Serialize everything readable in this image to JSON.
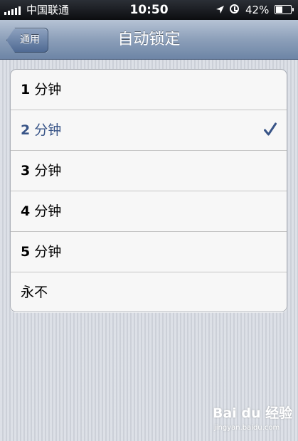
{
  "status_bar": {
    "carrier": "中国联通",
    "time": "10:50",
    "battery": "42%"
  },
  "nav": {
    "back_label": "通用",
    "title": "自动锁定"
  },
  "options": [
    {
      "num": "1",
      "unit": " 分钟"
    },
    {
      "num": "2",
      "unit": " 分钟",
      "selected": true
    },
    {
      "num": "3",
      "unit": " 分钟"
    },
    {
      "num": "4",
      "unit": " 分钟"
    },
    {
      "num": "5",
      "unit": " 分钟"
    },
    {
      "num": "",
      "unit": "永不"
    }
  ],
  "watermark": {
    "logo": "Bai du 经验",
    "url": "jingyan.baidu.com"
  },
  "colors": {
    "selected_text": "#385487",
    "nav_gradient_top": "#b6c3d5",
    "nav_gradient_bottom": "#6d85a6"
  }
}
